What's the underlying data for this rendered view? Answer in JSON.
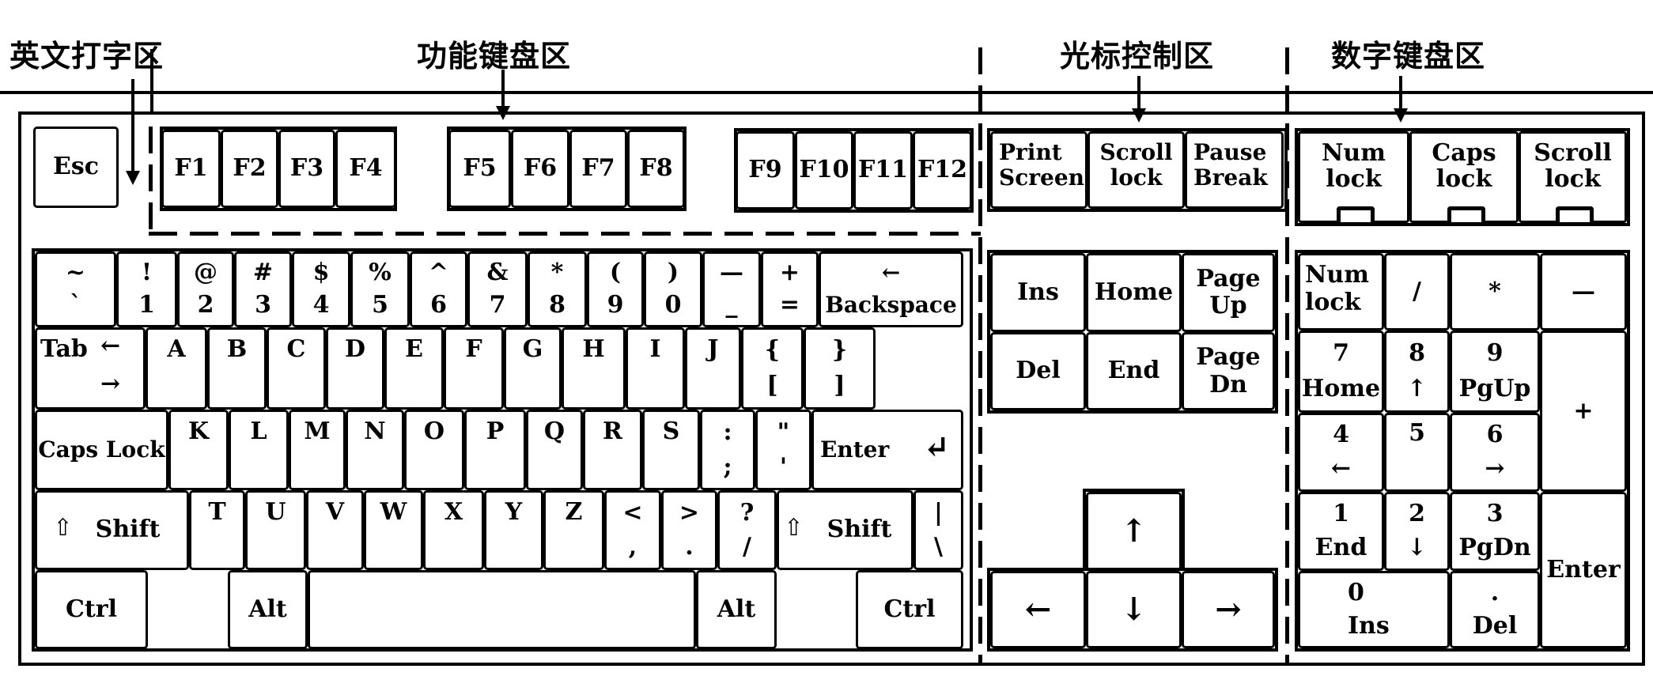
{
  "zone_labels": {
    "typing": "英文打字区",
    "function": "功能键盘区",
    "cursor": "光标控制区",
    "numpad": "数字键盘区"
  },
  "esc": "Esc",
  "function_keys": [
    "F1",
    "F2",
    "F3",
    "F4",
    "F5",
    "F6",
    "F7",
    "F8",
    "F9",
    "F10",
    "F11",
    "F12"
  ],
  "system_keys": [
    {
      "top": "Print",
      "bottom": "Screen"
    },
    {
      "top": "Scroll",
      "bottom": "lock"
    },
    {
      "top": "Pause",
      "bottom": "Break"
    }
  ],
  "indicators": [
    {
      "top": "Num",
      "bottom": "lock"
    },
    {
      "top": "Caps",
      "bottom": "lock"
    },
    {
      "top": "Scroll",
      "bottom": "lock"
    }
  ],
  "main": {
    "row1": [
      {
        "top": "~",
        "bottom": "`"
      },
      {
        "top": "!",
        "bottom": "1"
      },
      {
        "top": "@",
        "bottom": "2"
      },
      {
        "top": "#",
        "bottom": "3"
      },
      {
        "top": "$",
        "bottom": "4"
      },
      {
        "top": "%",
        "bottom": "5"
      },
      {
        "top": "^",
        "bottom": "6"
      },
      {
        "top": "&",
        "bottom": "7"
      },
      {
        "top": "*",
        "bottom": "8"
      },
      {
        "top": "(",
        "bottom": "9"
      },
      {
        "top": ")",
        "bottom": "0"
      },
      {
        "top": "—",
        "bottom": "_"
      },
      {
        "top": "+",
        "bottom": "="
      }
    ],
    "backspace": {
      "icon": "←",
      "label": "Backspace"
    },
    "tab": {
      "label": "Tab",
      "icon_top": "←",
      "icon_bottom": "→"
    },
    "row2": [
      "A",
      "B",
      "C",
      "D",
      "E",
      "F",
      "G",
      "H",
      "I",
      "J"
    ],
    "row2_brackets": [
      {
        "top": "{",
        "bottom": "["
      },
      {
        "top": "}",
        "bottom": "]"
      }
    ],
    "caps_lock": "Caps Lock",
    "row3": [
      "K",
      "L",
      "M",
      "N",
      "O",
      "P",
      "Q",
      "R",
      "S"
    ],
    "row3_punct": [
      {
        "top": ":",
        "bottom": ";"
      },
      {
        "top": "\"",
        "bottom": "'"
      }
    ],
    "enter": {
      "label": "Enter",
      "icon": "↵"
    },
    "shift_left": {
      "icon": "⇧",
      "label": "Shift"
    },
    "row4": [
      "T",
      "U",
      "V",
      "W",
      "X",
      "Y",
      "Z"
    ],
    "row4_punct": [
      {
        "top": "<",
        "bottom": ","
      },
      {
        "top": ">",
        "bottom": "."
      },
      {
        "top": "?",
        "bottom": "/"
      }
    ],
    "shift_right": {
      "icon": "⇧",
      "label": "Shift"
    },
    "pipe": {
      "top": "|",
      "bottom": "\\"
    },
    "ctrl_left": "Ctrl",
    "alt_left": "Alt",
    "space": "",
    "alt_right": "Alt",
    "ctrl_right": "Ctrl"
  },
  "cursor_block": {
    "ins": "Ins",
    "home": "Home",
    "page_up": {
      "top": "Page",
      "bottom": "Up"
    },
    "del": "Del",
    "end": "End",
    "page_down": {
      "top": "Page",
      "bottom": "Dn"
    },
    "arrows": {
      "up": "↑",
      "left": "←",
      "down": "↓",
      "right": "→"
    }
  },
  "numpad": {
    "num_lock": {
      "top": "Num",
      "bottom": "lock"
    },
    "divide": "/",
    "multiply": "*",
    "minus": "—",
    "plus": "+",
    "k7": {
      "top": "7",
      "bottom": "Home"
    },
    "k8": {
      "top": "8",
      "bottom": "↑"
    },
    "k9": {
      "top": "9",
      "bottom": "PgUp"
    },
    "k4": {
      "top": "4",
      "bottom": "←"
    },
    "k5": {
      "top": "5",
      "bottom": ""
    },
    "k6": {
      "top": "6",
      "bottom": "→"
    },
    "k1": {
      "top": "1",
      "bottom": "End"
    },
    "k2": {
      "top": "2",
      "bottom": "↓"
    },
    "k3": {
      "top": "3",
      "bottom": "PgDn"
    },
    "k0": {
      "top": "0",
      "bottom": "Ins"
    },
    "dot": {
      "top": ".",
      "bottom": "Del"
    },
    "enter": "Enter"
  }
}
